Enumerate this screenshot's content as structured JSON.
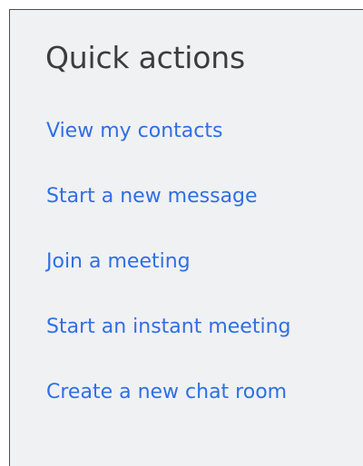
{
  "quick_actions": {
    "title": "Quick actions",
    "items": [
      {
        "label": "View my contacts"
      },
      {
        "label": "Start a new message"
      },
      {
        "label": "Join a meeting"
      },
      {
        "label": "Start an instant meeting"
      },
      {
        "label": "Create a new chat room"
      }
    ]
  },
  "colors": {
    "panel_background": "#f0f1f3",
    "title_text": "#3c3c3c",
    "link_text": "#2f6fe4",
    "border": "#505050"
  }
}
